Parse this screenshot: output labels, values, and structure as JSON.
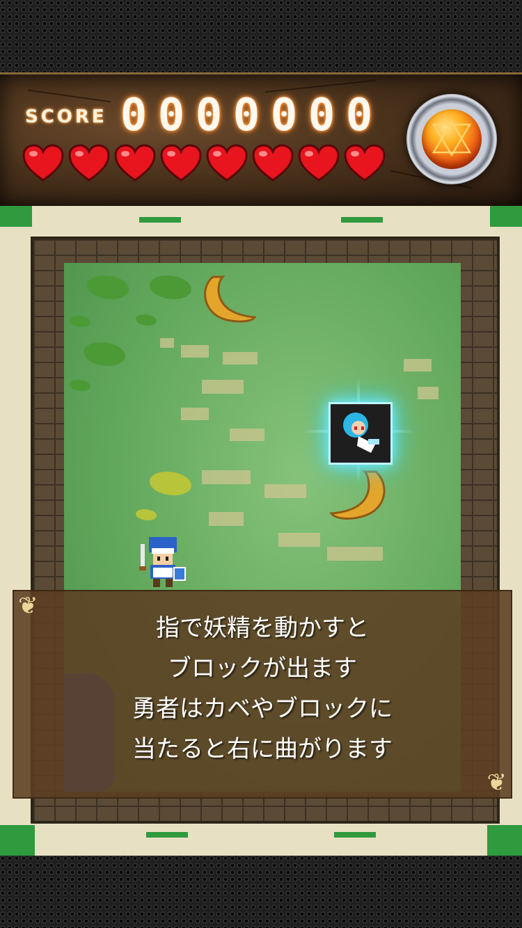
{
  "hud": {
    "score_label": "SCORE",
    "score_digits": [
      "0",
      "0",
      "0",
      "0",
      "0",
      "0",
      "0"
    ],
    "hearts_count": 8,
    "heart_color": "#e8141e",
    "orb_icon": "fairy-orb-icon"
  },
  "dialog": {
    "lines": [
      "指で妖精を動かすと",
      "ブロックが出ます",
      "勇者はカベやブロックに",
      "当たると右に曲がります"
    ]
  },
  "colors": {
    "grass": "#62a85c",
    "wall": "#5b4a36",
    "water": "#3a63b8",
    "dialog_bg": "#5c3e22"
  }
}
